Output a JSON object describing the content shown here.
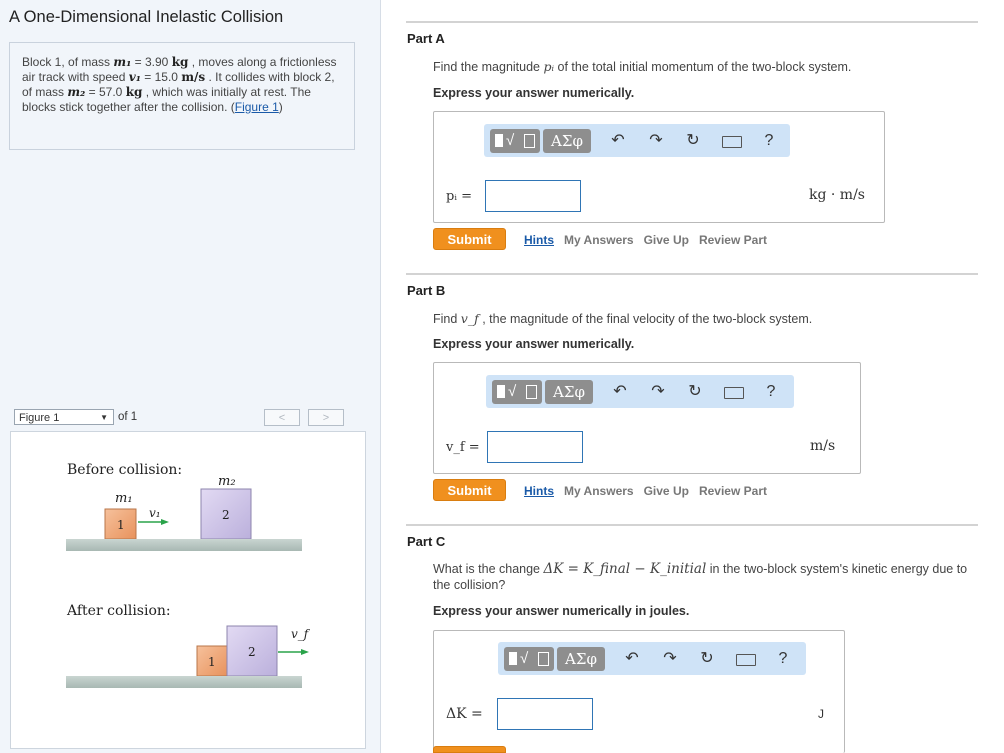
{
  "title": "A One-Dimensional Inelastic Collision",
  "problem": {
    "t1": "Block 1, of mass ",
    "m1": "m₁",
    "t2": " = 3.90 ",
    "u1": "kg",
    "t3": " , moves along a frictionless air track with speed ",
    "v1": "v₁",
    "t4": " = 15.0 ",
    "u2": "m/s",
    "t5": " . It collides with block 2, of mass ",
    "m2": "m₂",
    "t6": " = 57.0 ",
    "u3": "kg",
    "t7": " , which was initially at rest. The blocks stick together after the collision. (",
    "link": "Figure 1",
    "t8": ")"
  },
  "figure_nav": {
    "select_value": "Figure 1",
    "of_text": "of 1",
    "prev": "<",
    "next": ">"
  },
  "figure": {
    "before_label": "Before collision:",
    "after_label": "After collision:",
    "m1_label": "m₁",
    "m2_label": "m₂",
    "v1_label": "v₁",
    "vf_label": "v_f",
    "block1": "1",
    "block2": "2",
    "colors": {
      "block1": "#f0a878",
      "block2": "#cfc5e6",
      "track": "#b8c6c2",
      "arrow": "#2aa34a"
    }
  },
  "toolbar": {
    "greek": "ΑΣφ",
    "help": "?",
    "icons": [
      "undo-icon",
      "redo-icon",
      "reset-icon",
      "keyboard-icon",
      "help-icon"
    ]
  },
  "parts": [
    {
      "label": "Part A",
      "question_pre": "Find the magnitude ",
      "symbol": "pᵢ",
      "question_post": " of the total initial momentum of the two-block system.",
      "instruction": "Express your answer numerically.",
      "var_label": "pᵢ  =",
      "input_value": "",
      "unit": "kg · m/s",
      "submit": "Submit",
      "links": [
        "Hints",
        "My Answers",
        "Give Up",
        "Review Part"
      ]
    },
    {
      "label": "Part B",
      "question_pre": "Find ",
      "symbol": "v_f",
      "question_post": " , the magnitude of the final velocity of the two-block system.",
      "instruction": "Express your answer numerically.",
      "var_label": "v_f  =",
      "input_value": "",
      "unit": "m/s",
      "submit": "Submit",
      "links": [
        "Hints",
        "My Answers",
        "Give Up",
        "Review Part"
      ]
    },
    {
      "label": "Part C",
      "question_pre": "What is the change ",
      "symbol": "ΔK = K_final − K_initial",
      "question_post": " in the two-block system's kinetic energy due to the collision?",
      "instruction": "Express your answer numerically in joules.",
      "var_label": "ΔK =",
      "input_value": "",
      "unit": "J"
    }
  ]
}
